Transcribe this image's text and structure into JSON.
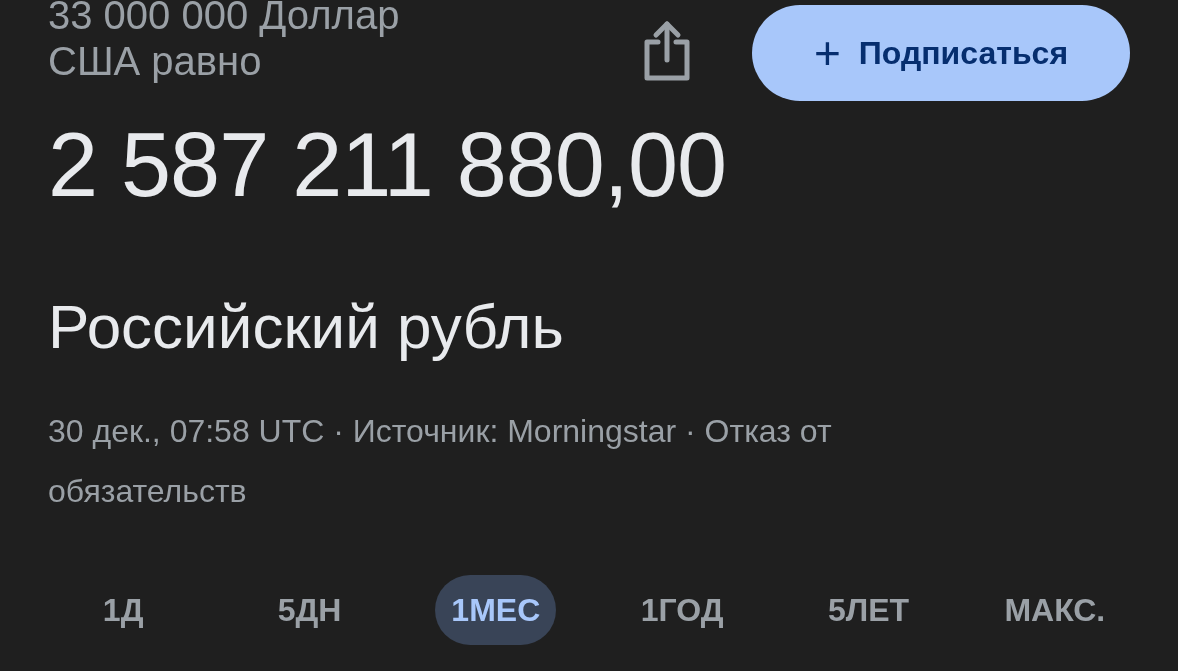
{
  "header": {
    "conversion_text": "33 000 000 Доллар США равно",
    "subscribe_button": {
      "icon": "+",
      "label": "Подписаться"
    }
  },
  "result": {
    "amount": "2 587 211 880,00",
    "currency": "Российский рубль"
  },
  "meta": "30 дек., 07:58 UTC · Источник: Morningstar · Отказ от обязательств",
  "ranges": [
    {
      "label": "1Д",
      "selected": false
    },
    {
      "label": "5ДН",
      "selected": false
    },
    {
      "label": "1МЕС",
      "selected": true
    },
    {
      "label": "1ГОД",
      "selected": false
    },
    {
      "label": "5ЛЕТ",
      "selected": false
    },
    {
      "label": "МАКС.",
      "selected": false
    }
  ]
}
